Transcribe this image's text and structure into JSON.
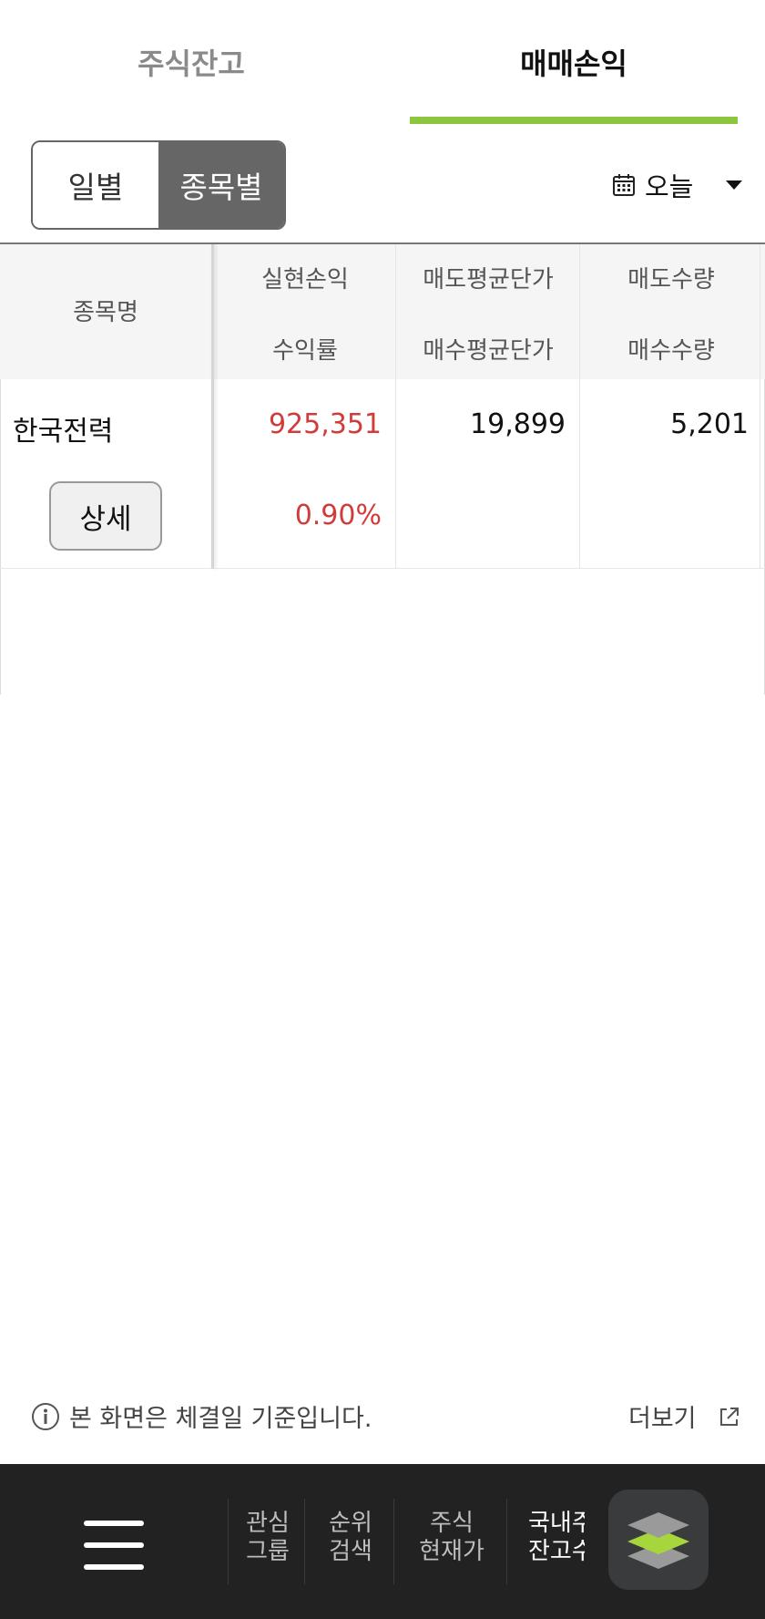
{
  "tabs": [
    {
      "label": "주식잔고",
      "active": false
    },
    {
      "label": "매매손익",
      "active": true
    }
  ],
  "accent_color": "#8cc63f",
  "toggle": {
    "daily": "일별",
    "by_stock": "종목별",
    "selected": "종목별"
  },
  "date_filter": {
    "value": "오늘",
    "icon": "calendar-icon"
  },
  "table": {
    "headers": {
      "name": "종목명",
      "realized_pl": "실현손익",
      "return_rate": "수익률",
      "sell_avg_price": "매도평균단가",
      "buy_avg_price": "매수평균단가",
      "sell_qty": "매도수량",
      "buy_qty": "매수수량"
    },
    "rows": [
      {
        "name": "한국전력",
        "detail_label": "상세",
        "realized_pl": "925,351",
        "return_rate": "0.90%",
        "sell_avg_price": "19,899",
        "buy_avg_price": "",
        "sell_qty": "5,201",
        "buy_qty": ""
      }
    ]
  },
  "profit_color": "#d23b3b",
  "footer": {
    "note": "본 화면은 체결일 기준입니다.",
    "more": "더보기"
  },
  "bottom_nav": {
    "items": [
      {
        "line1": "관심",
        "line2": "그룹"
      },
      {
        "line1": "순위",
        "line2": "검색"
      },
      {
        "line1": "주식",
        "line2": "현재가"
      },
      {
        "line1": "국내주",
        "line2": "잔고수"
      }
    ]
  }
}
